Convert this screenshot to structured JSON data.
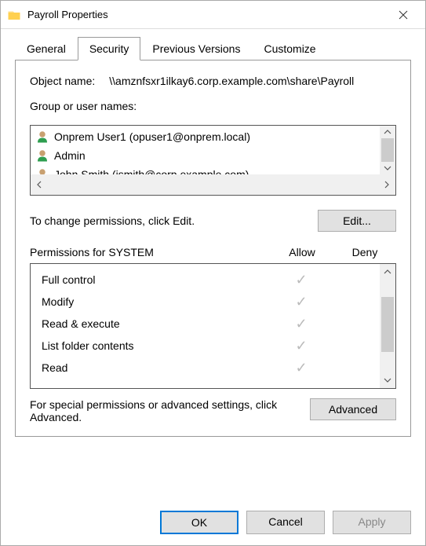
{
  "title": "Payroll Properties",
  "tabs": {
    "general": "General",
    "security": "Security",
    "previous": "Previous Versions",
    "customize": "Customize"
  },
  "object_name": {
    "label": "Object name:",
    "value": "\\\\amznfsxr1ilkay6.corp.example.com\\share\\Payroll"
  },
  "group_label": "Group or user names:",
  "users": [
    {
      "name": "Onprem User1 (opuser1@onprem.local)"
    },
    {
      "name": "Admin"
    },
    {
      "name": "John Smith (jsmith@corp.example.com)"
    }
  ],
  "edit_text": "To change permissions, click Edit.",
  "edit_button": "Edit...",
  "perm_header": {
    "title": "Permissions for SYSTEM",
    "allow": "Allow",
    "deny": "Deny"
  },
  "permissions": [
    {
      "name": "Full control",
      "allow": true
    },
    {
      "name": "Modify",
      "allow": true
    },
    {
      "name": "Read & execute",
      "allow": true
    },
    {
      "name": "List folder contents",
      "allow": true
    },
    {
      "name": "Read",
      "allow": true
    }
  ],
  "advanced_text": "For special permissions or advanced settings, click Advanced.",
  "advanced_button": "Advanced",
  "footer": {
    "ok": "OK",
    "cancel": "Cancel",
    "apply": "Apply"
  }
}
